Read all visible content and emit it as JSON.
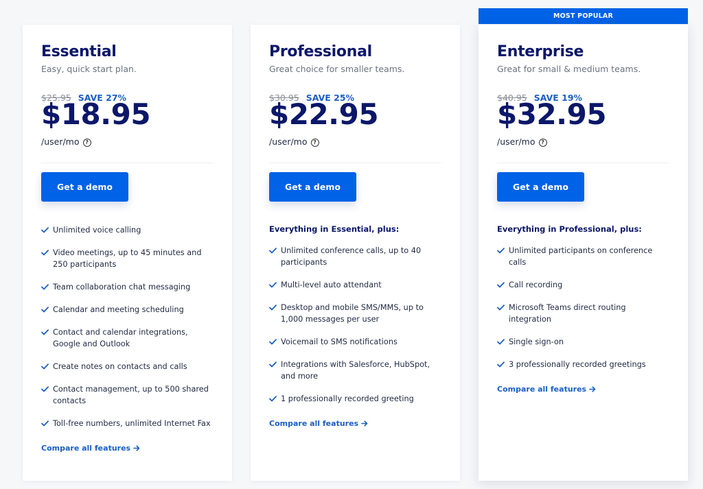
{
  "banner": {
    "label": "MOST POPULAR"
  },
  "colors": {
    "accent": "#0062e6",
    "navy": "#0b1769",
    "link": "#1b5fc4"
  },
  "plans": [
    {
      "name": "Essential",
      "description": "Easy, quick start plan.",
      "old_price": "$25.95",
      "save": "SAVE 27%",
      "price": "$18.95",
      "unit": "/user/mo",
      "cta": "Get a demo",
      "features_heading": "",
      "features": [
        "Unlimited voice calling",
        "Video meetings, up to 45 minutes and 250 participants",
        "Team collaboration chat messaging",
        "Calendar and meeting scheduling",
        "Contact and calendar integrations, Google and Outlook",
        "Create notes on contacts and calls",
        "Contact management, up to 500 shared contacts",
        "Toll-free numbers, unlimited Internet Fax"
      ],
      "compare_link": "Compare all features"
    },
    {
      "name": "Professional",
      "description": "Great choice for smaller teams.",
      "old_price": "$30.95",
      "save": "SAVE 25%",
      "price": "$22.95",
      "unit": "/user/mo",
      "cta": "Get a demo",
      "features_heading": "Everything in Essential, plus:",
      "features": [
        "Unlimited conference calls, up to 40 participants",
        "Multi-level auto attendant",
        "Desktop and mobile SMS/MMS, up to 1,000 messages per user",
        "Voicemail to SMS notifications",
        "Integrations with Salesforce, HubSpot, and more",
        "1 professionally recorded greeting"
      ],
      "compare_link": "Compare all features"
    },
    {
      "name": "Enterprise",
      "description": "Great for small & medium teams.",
      "old_price": "$40.95",
      "save": "SAVE 19%",
      "price": "$32.95",
      "unit": "/user/mo",
      "cta": "Get a demo",
      "features_heading": "Everything in Professional, plus:",
      "features": [
        "Unlimited participants on conference calls",
        "Call recording",
        "Microsoft Teams direct routing integration",
        "Single sign-on",
        "3 professionally recorded greetings"
      ],
      "compare_link": "Compare all features"
    }
  ],
  "icons": {
    "check": "check-icon",
    "help": "help-circle-icon",
    "arrow": "arrow-right-icon"
  }
}
